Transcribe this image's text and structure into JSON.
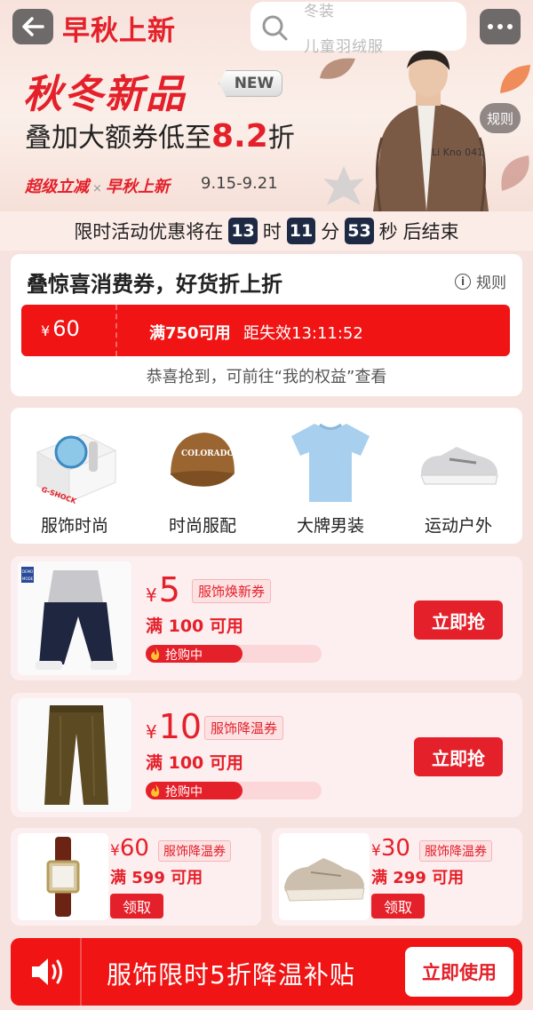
{
  "header": {
    "title": "早秋上新",
    "search_placeholder_line1": "冬装",
    "search_placeholder_line2": "儿童羽绒服"
  },
  "hero": {
    "headline": "秋冬新品",
    "new_badge": "NEW",
    "subline_prefix": "叠加大额券低至",
    "subline_discount": "8.2",
    "subline_suffix": "折",
    "tag_left": "超级立减",
    "tag_x": "×",
    "tag_right": "早秋上新",
    "date_range": "9.15-9.21",
    "rules_label": "规则",
    "model_shirt_text": "Li Kno 041"
  },
  "countdown": {
    "prefix": "限时活动优惠将在",
    "hours": "13",
    "hours_unit": "时",
    "minutes": "11",
    "minutes_unit": "分",
    "seconds": "53",
    "seconds_unit": "秒",
    "suffix": "后结束"
  },
  "coupon_card": {
    "title": "叠惊喜消费券，好货折上折",
    "rules_label": "规则",
    "currency": "¥",
    "amount": "60",
    "condition": "满750可用",
    "expiry": "距失效13:11:52",
    "tip": "恭喜抢到，可前往“我的权益”查看"
  },
  "categories": [
    {
      "label": "服饰时尚",
      "icon": "watch-gift-box-icon",
      "brand_text": "G-SHOCK"
    },
    {
      "label": "时尚服配",
      "icon": "baseball-cap-icon",
      "brand_text": "COLORADO"
    },
    {
      "label": "大牌男装",
      "icon": "tshirt-icon"
    },
    {
      "label": "运动户外",
      "icon": "sneaker-icon"
    }
  ],
  "promos": [
    {
      "currency": "¥",
      "amount": "5",
      "tag": "服饰焕新券",
      "min": "满 100 可用",
      "status": "抢购中",
      "progress": 0.55,
      "button": "立即抢",
      "image": "jeans-model-photo",
      "brand_line1": "DEMO",
      "brand_line2": "MODE"
    },
    {
      "currency": "¥",
      "amount": "10",
      "tag": "服饰降温券",
      "min": "满 100 可用",
      "status": "抢购中",
      "progress": 0.55,
      "button": "立即抢",
      "image": "corduroy-pants-photo"
    }
  ],
  "small_coupons": [
    {
      "currency": "¥",
      "amount": "60",
      "tag": "服饰降温券",
      "min": "满 599 可用",
      "button": "领取",
      "image": "wrist-watch-photo"
    },
    {
      "currency": "¥",
      "amount": "30",
      "tag": "服饰降温券",
      "min": "满 299 可用",
      "button": "领取",
      "image": "chunky-sneaker-photo"
    }
  ],
  "bottom_bar": {
    "message": "服饰限时5折降温补贴",
    "button": "立即使用"
  },
  "colors": {
    "brand_red": "#e4202a",
    "bar_red": "#f01414",
    "countdown_box": "#1e2a44",
    "page_bg": "#f6e3e0"
  }
}
